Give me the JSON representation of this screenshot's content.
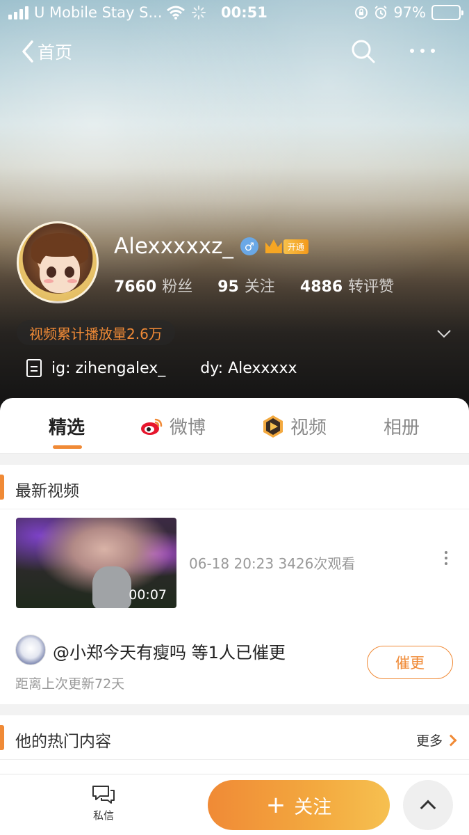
{
  "status_bar": {
    "carrier": "U Mobile Stay S...",
    "time": "00:51",
    "battery": "97%",
    "battery_level": 0.97
  },
  "nav": {
    "back_label": "首页"
  },
  "profile": {
    "username": "Alexxxxxz_",
    "vip_label": "开通",
    "stats": [
      {
        "num": "7660",
        "label": "粉丝"
      },
      {
        "num": "95",
        "label": "关注"
      },
      {
        "num": "4886",
        "label": "转评赞"
      }
    ],
    "play_badge": "视频累计播放量2.6万",
    "bio_ig": "ig: zihengalex_",
    "bio_dy": "dy: Alexxxxx"
  },
  "tabs": [
    {
      "label": "精选"
    },
    {
      "label": "微博"
    },
    {
      "label": "视频"
    },
    {
      "label": "相册"
    }
  ],
  "latest_video": {
    "section_title": "最新视频",
    "duration": "00:07",
    "meta": "06-18 20:23 3426次观看"
  },
  "reminder": {
    "text": "@小郑今天有瘦吗 等1人已催更",
    "sub": "距离上次更新72天",
    "button": "催更"
  },
  "hot": {
    "section_title": "他的热门内容",
    "more_label": "更多"
  },
  "bottom_bar": {
    "message_label": "私信",
    "follow_label": "关注",
    "accent": "#f08a36"
  },
  "icons": [
    "signal-icon",
    "wifi-icon",
    "loading-icon",
    "orientation-lock-icon",
    "alarm-icon",
    "battery-icon",
    "back-chevron-icon",
    "search-icon",
    "more-icon",
    "male-icon",
    "vip-crown-icon",
    "chevron-down-icon",
    "document-icon",
    "weibo-icon",
    "video-icon",
    "kebab-icon",
    "chat-icon",
    "chevron-up-icon"
  ]
}
